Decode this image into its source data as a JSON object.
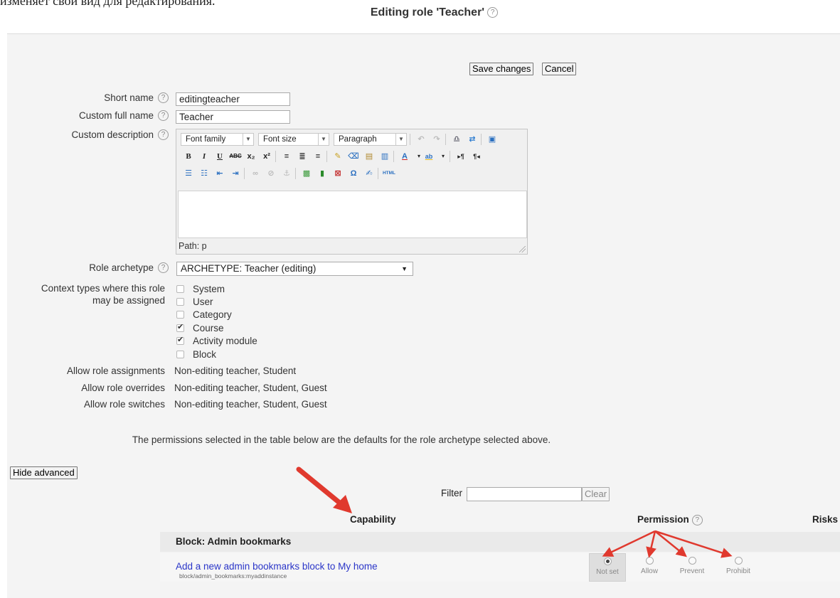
{
  "intro_text": "изменяет свой вид для редактирования.",
  "title": "Editing role 'Teacher'",
  "buttons": {
    "save": "Save changes",
    "cancel": "Cancel",
    "hide_advanced": "Hide advanced",
    "clear": "Clear"
  },
  "fields": {
    "short_name": {
      "label": "Short name",
      "value": "editingteacher"
    },
    "full_name": {
      "label": "Custom full name",
      "value": "Teacher"
    },
    "description": {
      "label": "Custom description"
    },
    "archetype": {
      "label": "Role archetype",
      "value": "ARCHETYPE: Teacher (editing)"
    },
    "context": {
      "label_line1": "Context types where this role",
      "label_line2": "may be assigned"
    }
  },
  "editor": {
    "font_family": "Font family",
    "font_size": "Font size",
    "paragraph": "Paragraph",
    "path": "Path: p"
  },
  "context_types": [
    {
      "label": "System",
      "checked": false
    },
    {
      "label": "User",
      "checked": false
    },
    {
      "label": "Category",
      "checked": false
    },
    {
      "label": "Course",
      "checked": true
    },
    {
      "label": "Activity module",
      "checked": true
    },
    {
      "label": "Block",
      "checked": false
    }
  ],
  "allow": {
    "assignments": {
      "label": "Allow role assignments",
      "value": "Non-editing teacher, Student"
    },
    "overrides": {
      "label": "Allow role overrides",
      "value": "Non-editing teacher, Student, Guest"
    },
    "switches": {
      "label": "Allow role switches",
      "value": "Non-editing teacher, Student, Guest"
    }
  },
  "note": "The permissions selected in the table below are the defaults for the role archetype selected above.",
  "filter": {
    "label": "Filter",
    "value": ""
  },
  "table": {
    "headers": {
      "capability": "Capability",
      "permission": "Permission",
      "risks": "Risks"
    },
    "group": "Block: Admin bookmarks",
    "row": {
      "name": "Add a new admin bookmarks block to My home",
      "code": "block/admin_bookmarks:myaddinstance",
      "permissions": [
        "Not set",
        "Allow",
        "Prevent",
        "Prohibit"
      ],
      "selected": "Not set"
    }
  },
  "colors": {
    "arrow": "#e0392e",
    "link": "#2a35c8"
  }
}
